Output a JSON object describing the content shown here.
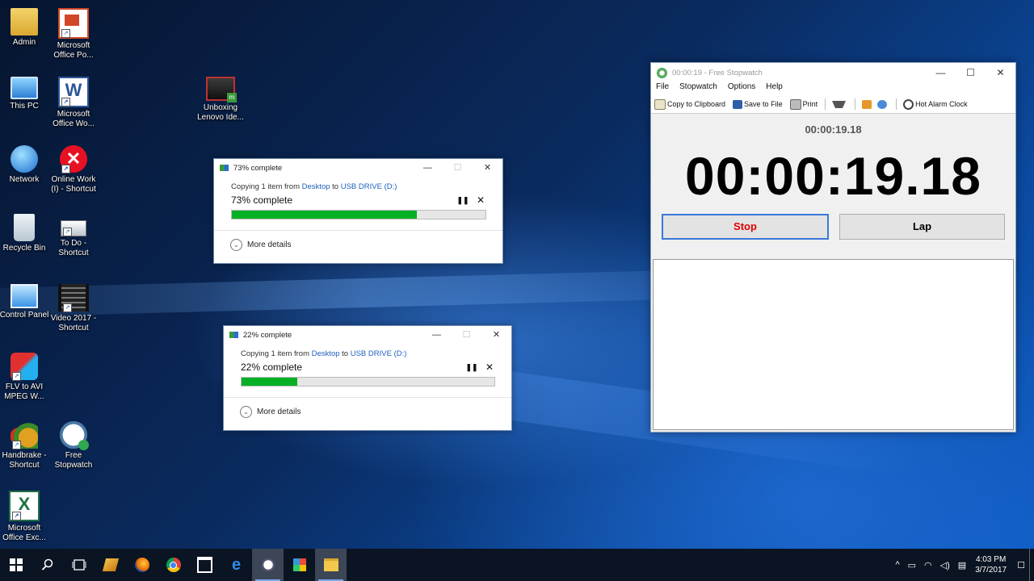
{
  "desktop": {
    "icons": [
      {
        "label1": "Admin",
        "label2": ""
      },
      {
        "label1": "Microsoft",
        "label2": "Office Po..."
      },
      {
        "label1": "This PC",
        "label2": ""
      },
      {
        "label1": "Microsoft",
        "label2": "Office Wo..."
      },
      {
        "label1": "Unboxing",
        "label2": "Lenovo Ide..."
      },
      {
        "label1": "Network",
        "label2": ""
      },
      {
        "label1": "Online Work",
        "label2": "(I) - Shortcut"
      },
      {
        "label1": "Recycle Bin",
        "label2": ""
      },
      {
        "label1": "To Do -",
        "label2": "Shortcut"
      },
      {
        "label1": "Control Panel",
        "label2": ""
      },
      {
        "label1": "Video 2017 -",
        "label2": "Shortcut"
      },
      {
        "label1": "FLV to AVI",
        "label2": "MPEG W..."
      },
      {
        "label1": "Handbrake -",
        "label2": "Shortcut"
      },
      {
        "label1": "Free",
        "label2": "Stopwatch"
      },
      {
        "label1": "Microsoft",
        "label2": "Office Exc..."
      }
    ]
  },
  "copy1": {
    "title": "73% complete",
    "copying_prefix": "Copying 1 item from ",
    "source": "Desktop",
    "to_word": " to ",
    "dest": "USB DRIVE (D:)",
    "percent_label": "73% complete",
    "progress": 0.73,
    "more_details": "More details"
  },
  "copy2": {
    "title": "22% complete",
    "copying_prefix": "Copying 1 item from ",
    "source": "Desktop",
    "to_word": " to ",
    "dest": "USB DRIVE (D:)",
    "percent_label": "22% complete",
    "progress": 0.22,
    "more_details": "More details"
  },
  "stopwatch": {
    "window_title": "00:00:19 - Free Stopwatch",
    "menu": [
      "File",
      "Stopwatch",
      "Options",
      "Help"
    ],
    "toolbar": {
      "copy": "Copy to Clipboard",
      "save": "Save to File",
      "print": "Print",
      "alarm": "Hot Alarm Clock"
    },
    "small_time": "00:00:19.18",
    "big_time": "00:00:19.18",
    "stop_label": "Stop",
    "lap_label": "Lap"
  },
  "taskbar": {
    "time": "4:03 PM",
    "date": "3/7/2017"
  }
}
